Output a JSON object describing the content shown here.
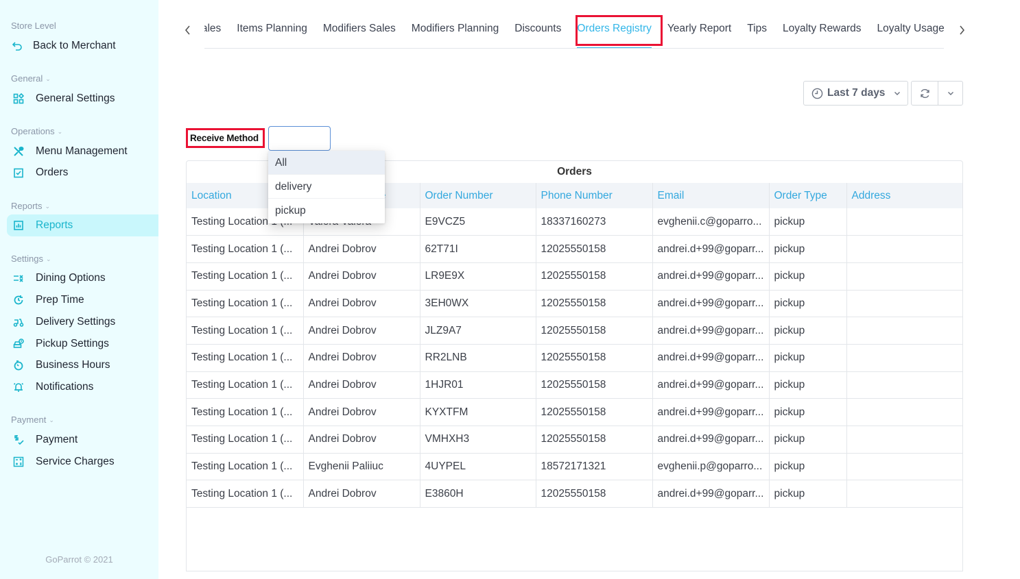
{
  "sidebar": {
    "store_level_label": "Store Level",
    "back_label": "Back to Merchant",
    "sections": {
      "general": "General",
      "operations": "Operations",
      "reports": "Reports",
      "settings": "Settings",
      "payment": "Payment"
    },
    "items": {
      "general_settings": "General Settings",
      "menu_management": "Menu Management",
      "orders": "Orders",
      "reports": "Reports",
      "dining_options": "Dining Options",
      "prep_time": "Prep Time",
      "delivery_settings": "Delivery Settings",
      "pickup_settings": "Pickup Settings",
      "business_hours": "Business Hours",
      "notifications": "Notifications",
      "payment": "Payment",
      "service_charges": "Service Charges"
    },
    "active_item": "Reports",
    "footer": "GoParrot © 2021"
  },
  "tabs": {
    "items": [
      "Sales",
      "Items Planning",
      "Modifiers Sales",
      "Modifiers Planning",
      "Discounts",
      "Orders Registry",
      "Yearly Report",
      "Tips",
      "Loyalty Rewards",
      "Loyalty Usage"
    ],
    "active": "Orders Registry"
  },
  "toolbar": {
    "date_range": "Last 7 days"
  },
  "filter": {
    "label": "Receive Method",
    "value": "",
    "options": [
      "All",
      "delivery",
      "pickup"
    ],
    "highlighted_option": "All"
  },
  "table": {
    "title": "Orders",
    "columns": [
      "Location",
      "Customer Name",
      "Order Number",
      "Phone Number",
      "Email",
      "Order Type",
      "Address"
    ],
    "rows": [
      [
        "Testing Location 1 (...",
        "Valera Valera",
        "E9VCZ5",
        "18337160273",
        "evghenii.c@goparro...",
        "pickup",
        ""
      ],
      [
        "Testing Location 1 (...",
        "Andrei Dobrov",
        "62T71I",
        "12025550158",
        "andrei.d+99@goparr...",
        "pickup",
        ""
      ],
      [
        "Testing Location 1 (...",
        "Andrei Dobrov",
        "LR9E9X",
        "12025550158",
        "andrei.d+99@goparr...",
        "pickup",
        ""
      ],
      [
        "Testing Location 1 (...",
        "Andrei Dobrov",
        "3EH0WX",
        "12025550158",
        "andrei.d+99@goparr...",
        "pickup",
        ""
      ],
      [
        "Testing Location 1 (...",
        "Andrei Dobrov",
        "JLZ9A7",
        "12025550158",
        "andrei.d+99@goparr...",
        "pickup",
        ""
      ],
      [
        "Testing Location 1 (...",
        "Andrei Dobrov",
        "RR2LNB",
        "12025550158",
        "andrei.d+99@goparr...",
        "pickup",
        ""
      ],
      [
        "Testing Location 1 (...",
        "Andrei Dobrov",
        "1HJR01",
        "12025550158",
        "andrei.d+99@goparr...",
        "pickup",
        ""
      ],
      [
        "Testing Location 1 (...",
        "Andrei Dobrov",
        "KYXTFM",
        "12025550158",
        "andrei.d+99@goparr...",
        "pickup",
        ""
      ],
      [
        "Testing Location 1 (...",
        "Andrei Dobrov",
        "VMHXH3",
        "12025550158",
        "andrei.d+99@goparr...",
        "pickup",
        ""
      ],
      [
        "Testing Location 1 (...",
        "Evghenii Paliiuc",
        "4UYPEL",
        "18572171321",
        "evghenii.p@goparro...",
        "pickup",
        ""
      ],
      [
        "Testing Location 1 (...",
        "Andrei Dobrov",
        "E3860H",
        "12025550158",
        "andrei.d+99@goparr...",
        "pickup",
        ""
      ]
    ]
  },
  "colors": {
    "accent": "#1ab5cc",
    "tab_active": "#33b6e8",
    "highlight": "#ea1234",
    "sidebar_bg": "#ecfdff"
  }
}
